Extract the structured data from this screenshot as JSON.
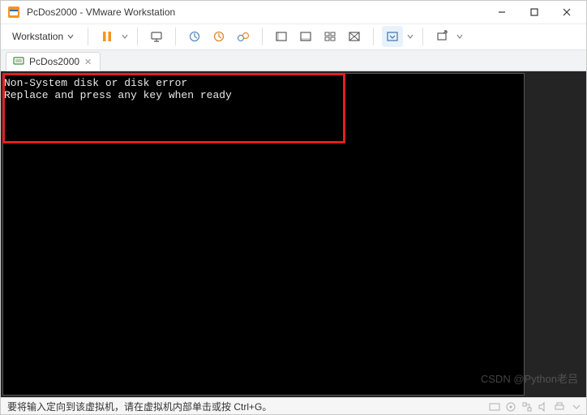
{
  "window": {
    "title": "PcDos2000 - VMware Workstation"
  },
  "menu": {
    "workstation_label": "Workstation"
  },
  "tabs": [
    {
      "label": "PcDos2000"
    }
  ],
  "console": {
    "line1": "Non-System disk or disk error",
    "line2": "Replace and press any key when ready"
  },
  "statusbar": {
    "hint": "要将输入定向到该虚拟机，请在虚拟机内部单击或按 Ctrl+G。"
  },
  "watermark": "CSDN @Python老吕"
}
